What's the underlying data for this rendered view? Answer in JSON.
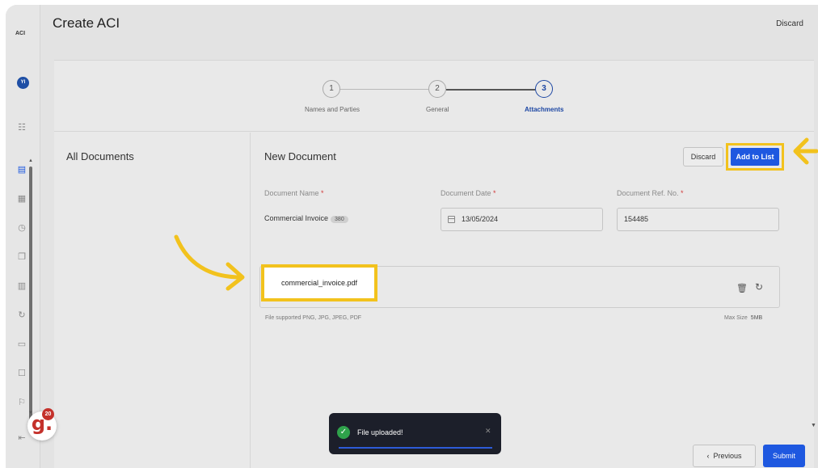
{
  "app": {
    "logo_text": "ACI",
    "avatar_initials": "YI",
    "title": "Create ACI",
    "header_discard": "Discard"
  },
  "stepper": {
    "steps": [
      {
        "number": "1",
        "label": "Names and Parties"
      },
      {
        "number": "2",
        "label": "General"
      },
      {
        "number": "3",
        "label": "Attachments"
      }
    ]
  },
  "left_panel": {
    "title": "All Documents"
  },
  "document": {
    "title": "New Document",
    "discard_label": "Discard",
    "add_label": "Add to List",
    "fields": {
      "name": {
        "label": "Document Name",
        "value": "Commercial Invoice",
        "code": "380"
      },
      "date": {
        "label": "Document Date",
        "value": "13/05/2024"
      },
      "ref": {
        "label": "Document Ref. No.",
        "value": "154485"
      }
    },
    "required_mark": "*",
    "file_name": "commercial_invoice.pdf",
    "supported": "File supported PNG, JPG, JPEG, PDF",
    "max_size_label": "Max Size",
    "max_size_value": "5MB"
  },
  "footer": {
    "previous_label": "Previous",
    "submit_label": "Submit"
  },
  "toast": {
    "message": "File uploaded!"
  },
  "badge": {
    "logo": "g.",
    "count": "20"
  },
  "colors": {
    "accent": "#1e58e0",
    "highlight": "#f2c21d",
    "toast_bg": "#1c1f2a",
    "success": "#2fa24b",
    "brand_red": "#c4312b"
  }
}
